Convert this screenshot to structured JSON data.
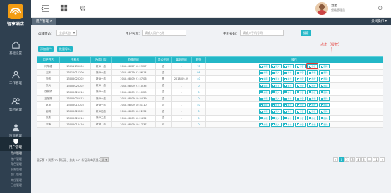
{
  "app": {
    "logo_text": "智享酒店"
  },
  "sidebar": {
    "items": [
      {
        "label": "基础设置",
        "icon": "home-icon"
      },
      {
        "label": "工作管理",
        "icon": "user-icon"
      },
      {
        "label": "集团管理",
        "icon": "people-icon"
      },
      {
        "label": "项目管理",
        "icon": "person-icon"
      },
      {
        "label": "用户管理",
        "icon": "shield-icon"
      }
    ],
    "submenu": [
      "用户管理",
      "账户管理",
      "角色管理",
      "权限管理",
      "部门管理",
      "岗位管理",
      "日志管理"
    ]
  },
  "header": {
    "user_name": "酒酒",
    "user_role": "超级管理员"
  },
  "tabs": {
    "active": "用户管理 ×",
    "close_label": "关闭操作 ▾"
  },
  "filters": {
    "status_label": "选择状态：",
    "status_value": "全部状态",
    "name_label": "用户名称：",
    "name_placeholder": "请输入用户名称",
    "phone_label": "手机号码：",
    "phone_placeholder": "请输入手机号码",
    "search_label": "搜索"
  },
  "actions": {
    "add_label": "添加用户",
    "import_label": "批量导入"
  },
  "annotation": {
    "text": "点击【授权】"
  },
  "table": {
    "headers": [
      "用户姓名",
      "手机号",
      "所属门店",
      "办理时间",
      "是否在职",
      "离职时间",
      "积分",
      "操作"
    ],
    "rows": [
      [
        "冯华峰",
        "13011135000",
        "新添一店",
        "2018-08-27 10:23:27",
        "否",
        "-",
        "78"
      ],
      [
        "王辉",
        "13011011300",
        "新添一店",
        "2018-08-29 21:36:14",
        "否",
        "-",
        "86"
      ],
      [
        "张帆",
        "13002020202",
        "新添一店",
        "2018-08-09 21:37:06",
        "是",
        "2018-09-09",
        "40"
      ],
      [
        "张兵",
        "13002020202",
        "新添一店",
        "2018-08-09 21:10:35",
        "否",
        "-",
        "0"
      ],
      [
        "张娴娟",
        "13002021010",
        "新添一店",
        "2018-08-09 21:10:20",
        "否",
        "-",
        "0"
      ],
      [
        "王旭刚",
        "13002031012",
        "新添一店",
        "2018-08-09 10:34:39",
        "否",
        "-",
        "0"
      ],
      [
        "赵勇",
        "13002010203",
        "新添一店",
        "2018-08-09 10:31:10",
        "否",
        "-",
        "40"
      ],
      [
        "赵明",
        "13002020202",
        "新添旧店",
        "2018-08-09 10:22:32",
        "否",
        "-",
        "0"
      ],
      [
        "张杰",
        "13002021010",
        "新添二店",
        "2018-08-09 10:24:32",
        "否",
        "-",
        "0"
      ],
      [
        "张辉",
        "13002010410",
        "新添二店",
        "2018-08-09 10:17:37",
        "否",
        "-",
        "0"
      ]
    ],
    "row_ops": [
      "编辑",
      "账户",
      "补卡",
      "卡密",
      "授权",
      "删除"
    ]
  },
  "pagination": {
    "summary": "显示第 1 到第 10 条记录，总共 102 条记录 每页显示",
    "page_size": "10 ▾",
    "pages": [
      "‹",
      "1",
      "2",
      "3",
      "4",
      "5",
      "…",
      "11",
      "›"
    ],
    "active": "1"
  },
  "colors": {
    "sidebar": "#2f4050",
    "accent": "#23b7c7",
    "annotation": "#e53935"
  }
}
